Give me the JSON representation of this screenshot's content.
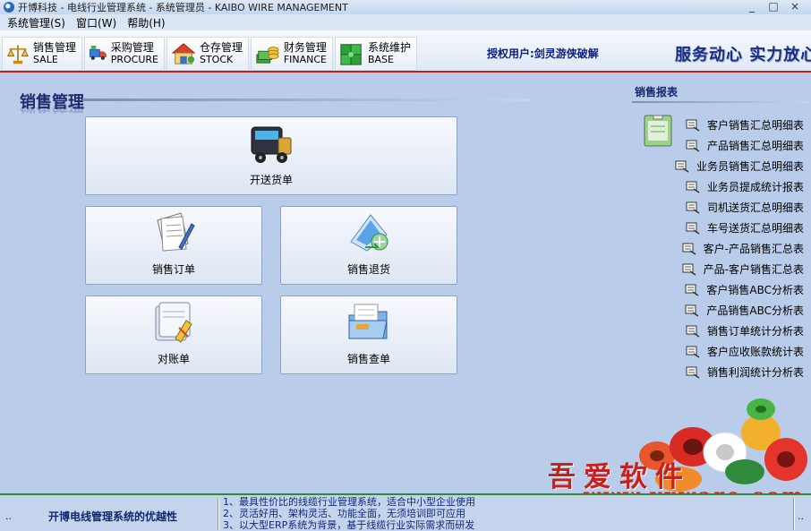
{
  "window": {
    "title": "开博科技 - 电线行业管理系统 - 系统管理员 - KAIBO WIRE MANAGEMENT",
    "minimize": "_",
    "maximize": "□",
    "close": "×"
  },
  "menu": [
    "系统管理(S)",
    "窗口(W)",
    "帮助(H)"
  ],
  "modules": [
    {
      "cn": "销售管理",
      "en": "SALE",
      "icon": "scale-icon"
    },
    {
      "cn": "采购管理",
      "en": "PROCURE",
      "icon": "truck-icon"
    },
    {
      "cn": "仓存管理",
      "en": "STOCK",
      "icon": "warehouse-icon"
    },
    {
      "cn": "财务管理",
      "en": "FINANCE",
      "icon": "money-icon"
    },
    {
      "cn": "系统维护",
      "en": "BASE",
      "icon": "puzzle-icon"
    }
  ],
  "auth_user": "授权用户:剑灵游侠破解",
  "slogan": "服务动心 实力放心",
  "main": {
    "title": "销售管理",
    "buttons": [
      {
        "label": "开送货单",
        "icon": "truck-icon"
      },
      {
        "label": "销售订单",
        "icon": "document-pen-icon"
      },
      {
        "label": "销售退货",
        "icon": "return-icon"
      },
      {
        "label": "对账单",
        "icon": "reconcile-icon"
      },
      {
        "label": "销售查单",
        "icon": "folder-search-icon"
      }
    ]
  },
  "reports": {
    "title": "销售报表",
    "items": [
      "客户销售汇总明细表",
      "产品销售汇总明细表",
      "业务员销售汇总明细表",
      "业务员提成统计报表",
      "司机送货汇总明细表",
      "车号送货汇总明细表",
      "客户-产品销售汇总表",
      "产品-客户销售汇总表",
      "客户销售ABC分析表",
      "产品销售ABC分析表",
      "销售订单统计分析表",
      "客户应收账款统计表",
      "销售利润统计分析表"
    ]
  },
  "watermark": {
    "text": "吾爱软件",
    "url": "www.yxware.com"
  },
  "status": {
    "left_dots": "..",
    "title": "开博电线管理系统的优越性",
    "lines": [
      "1、最具性价比的线缆行业管理系统，适合中小型企业使用",
      "2、灵活好用、架构灵活、功能全面，无须培训即可应用",
      "3、以大型ERP系统为背景，基于线缆行业实际需求而研发"
    ],
    "right_dots": ".."
  },
  "colors": {
    "accent_red": "#c01c1c",
    "navy": "#13286c",
    "background": "#b9cdeb",
    "status_green": "#2f8a3c"
  }
}
